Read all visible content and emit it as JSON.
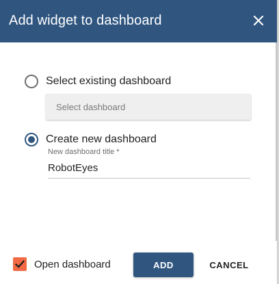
{
  "dialog": {
    "title": "Add widget to dashboard",
    "close_icon": "close-icon"
  },
  "options": {
    "existing": {
      "label": "Select existing dashboard",
      "selected": false
    },
    "select_placeholder": "Select dashboard",
    "new": {
      "label": "Create new dashboard",
      "selected": true
    },
    "title_field": {
      "label": "New dashboard title *",
      "value": "RobotEyes"
    }
  },
  "footer": {
    "open_dashboard_label": "Open dashboard",
    "open_dashboard_checked": true,
    "add_label": "ADD",
    "cancel_label": "CANCEL"
  },
  "colors": {
    "primary": "#305680",
    "accent": "#f26a45"
  }
}
